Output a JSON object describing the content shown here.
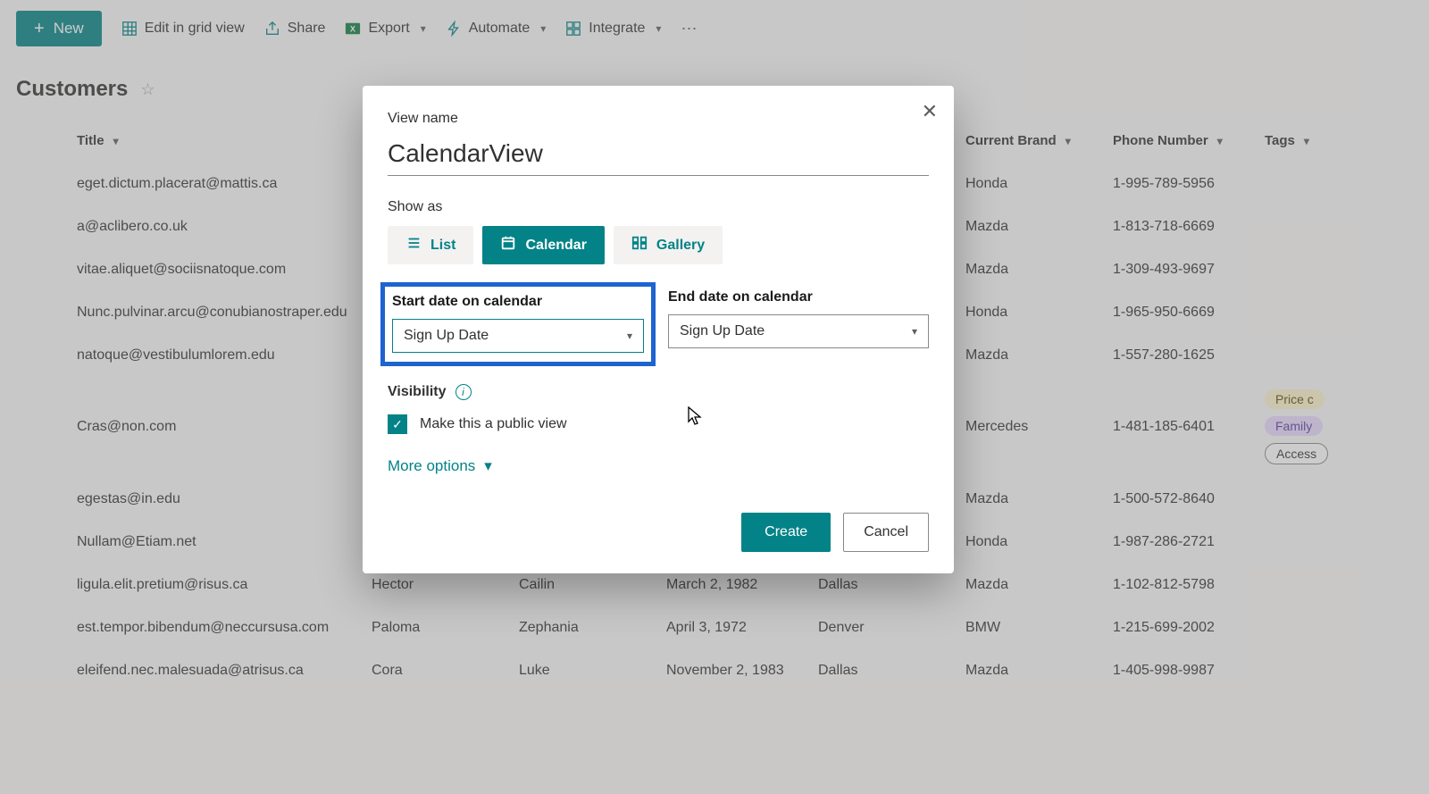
{
  "commandBar": {
    "new": "New",
    "editGrid": "Edit in grid view",
    "share": "Share",
    "export": "Export",
    "automate": "Automate",
    "integrate": "Integrate"
  },
  "page": {
    "title": "Customers"
  },
  "columns": {
    "title": "Title",
    "currentBrand": "Current Brand",
    "phone": "Phone Number",
    "tags": "Tags"
  },
  "rows": [
    {
      "title": "eget.dictum.placerat@mattis.ca",
      "brand": "Honda",
      "phone": "1-995-789-5956"
    },
    {
      "title": "a@aclibero.co.uk",
      "brand": "Mazda",
      "phone": "1-813-718-6669"
    },
    {
      "title": "vitae.aliquet@sociisnatoque.com",
      "brand": "Mazda",
      "phone": "1-309-493-9697",
      "comment": true
    },
    {
      "title": "Nunc.pulvinar.arcu@conubianostraper.edu",
      "brand": "Honda",
      "phone": "1-965-950-6669"
    },
    {
      "title": "natoque@vestibulumlorem.edu",
      "brand": "Mazda",
      "phone": "1-557-280-1625"
    },
    {
      "title": "Cras@non.com",
      "brand": "Mercedes",
      "phone": "1-481-185-6401",
      "tags": [
        "Price c",
        "Family",
        "Access"
      ]
    },
    {
      "title": "egestas@in.edu",
      "brand": "Mazda",
      "phone": "1-500-572-8640"
    },
    {
      "title": "Nullam@Etiam.net",
      "brand": "Honda",
      "phone": "1-987-286-2721"
    },
    {
      "title": "ligula.elit.pretium@risus.ca",
      "first": "Hector",
      "last": "Cailin",
      "dob": "March 2, 1982",
      "city": "Dallas",
      "brand": "Mazda",
      "phone": "1-102-812-5798"
    },
    {
      "title": "est.tempor.bibendum@neccursusa.com",
      "first": "Paloma",
      "last": "Zephania",
      "dob": "April 3, 1972",
      "city": "Denver",
      "brand": "BMW",
      "phone": "1-215-699-2002"
    },
    {
      "title": "eleifend.nec.malesuada@atrisus.ca",
      "first": "Cora",
      "last": "Luke",
      "dob": "November 2, 1983",
      "city": "Dallas",
      "brand": "Mazda",
      "phone": "1-405-998-9987"
    }
  ],
  "dialog": {
    "viewNameLabel": "View name",
    "viewNameValue": "CalendarView",
    "showAsLabel": "Show as",
    "seg": {
      "list": "List",
      "calendar": "Calendar",
      "gallery": "Gallery"
    },
    "startLabel": "Start date on calendar",
    "startValue": "Sign Up Date",
    "endLabel": "End date on calendar",
    "endValue": "Sign Up Date",
    "visibilityLabel": "Visibility",
    "publicLabel": "Make this a public view",
    "moreOptions": "More options",
    "create": "Create",
    "cancel": "Cancel"
  }
}
